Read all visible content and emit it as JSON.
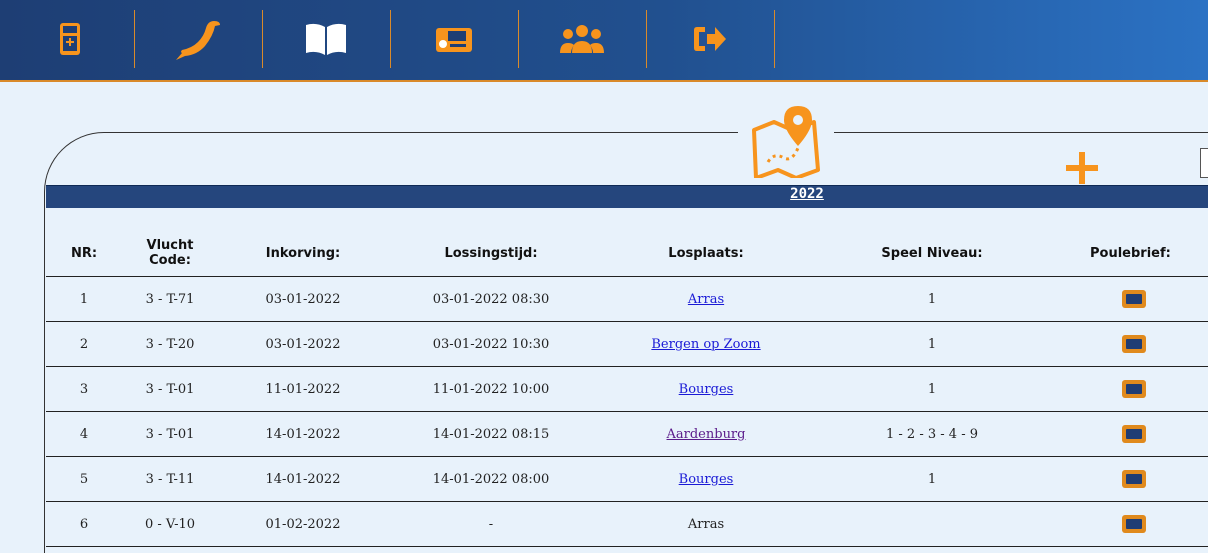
{
  "nav": {
    "items": [
      {
        "name": "calculator-icon"
      },
      {
        "name": "pigeon-icon"
      },
      {
        "name": "book-icon"
      },
      {
        "name": "timer-device-icon"
      },
      {
        "name": "users-icon"
      },
      {
        "name": "logout-icon"
      }
    ],
    "accent_color": "#f7941d"
  },
  "section": {
    "icon": "map-pin-icon",
    "add_icon": "plus-icon",
    "year": "2022"
  },
  "table": {
    "headers": {
      "nr": "NR:",
      "code_line1": "Vlucht",
      "code_line2": "Code:",
      "inkorving": "Inkorving:",
      "lossingstijd": "Lossingstijd:",
      "losplaats": "Losplaats:",
      "niveau": "Speel Niveau:",
      "poulebrief": "Poulebrief:"
    },
    "rows": [
      {
        "nr": "1",
        "code": "3 - T-71",
        "inkorving": "03-01-2022",
        "lossingstijd": "03-01-2022 08:30",
        "losplaats": "Arras",
        "link": true,
        "visited": false,
        "niveau": "1"
      },
      {
        "nr": "2",
        "code": "3 - T-20",
        "inkorving": "03-01-2022",
        "lossingstijd": "03-01-2022 10:30",
        "losplaats": "Bergen op Zoom",
        "link": true,
        "visited": false,
        "niveau": "1"
      },
      {
        "nr": "3",
        "code": "3 - T-01",
        "inkorving": "11-01-2022",
        "lossingstijd": "11-01-2022 10:00",
        "losplaats": "Bourges",
        "link": true,
        "visited": false,
        "niveau": "1"
      },
      {
        "nr": "4",
        "code": "3 - T-01",
        "inkorving": "14-01-2022",
        "lossingstijd": "14-01-2022 08:15",
        "losplaats": "Aardenburg",
        "link": true,
        "visited": true,
        "niveau": "1 - 2 - 3 - 4 - 9"
      },
      {
        "nr": "5",
        "code": "3 - T-11",
        "inkorving": "14-01-2022",
        "lossingstijd": "14-01-2022 08:00",
        "losplaats": "Bourges",
        "link": true,
        "visited": false,
        "niveau": "1"
      },
      {
        "nr": "6",
        "code": "0 - V-10",
        "inkorving": "01-02-2022",
        "lossingstijd": "-",
        "losplaats": "Arras",
        "link": false,
        "visited": false,
        "niveau": ""
      }
    ]
  }
}
